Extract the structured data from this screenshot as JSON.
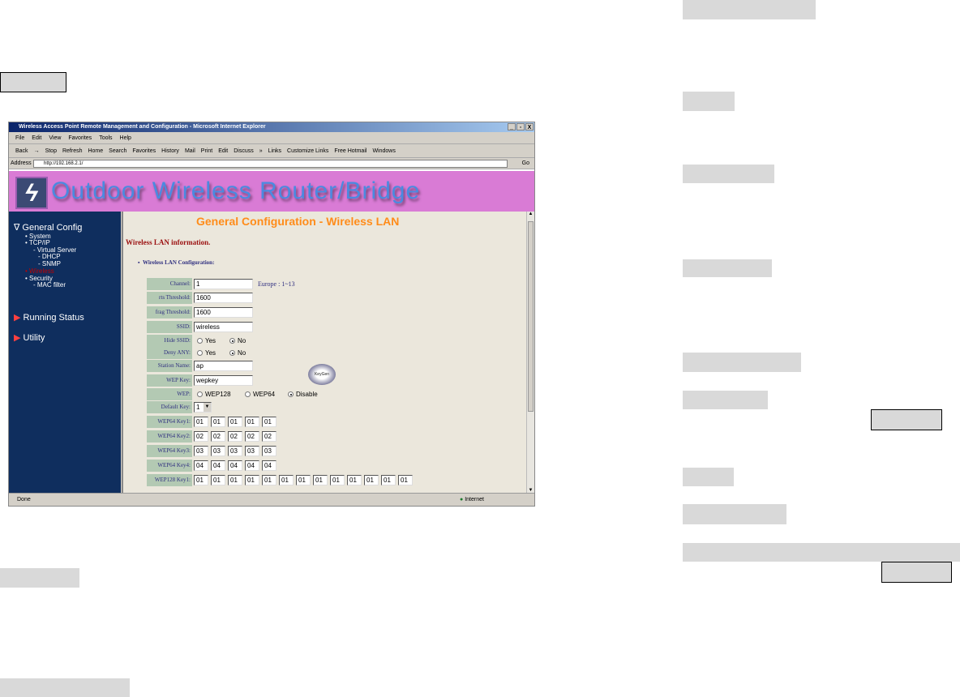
{
  "browser": {
    "title": "Wireless Access Point Remote Management and Configuration - Microsoft Internet Explorer",
    "window_buttons": [
      "_",
      "▫",
      "X"
    ],
    "menu": [
      "File",
      "Edit",
      "View",
      "Favorites",
      "Tools",
      "Help"
    ],
    "toolbar": [
      "Back",
      "→",
      "Stop",
      "Refresh",
      "Home",
      "Search",
      "Favorites",
      "History",
      "Mail",
      "Print",
      "Edit",
      "Discuss",
      "»",
      "Links",
      "Customize Links",
      "Free Hotmail",
      "Windows"
    ],
    "address_label": "Address",
    "address": "http://192.168.2.1/",
    "go": "Go",
    "status_left": "Done",
    "status_zone": "Internet"
  },
  "banner": {
    "title": "Outdoor Wireless Router/Bridge"
  },
  "sidebar": {
    "general": "∇ General Config",
    "items": [
      "• System",
      "• TCP/IP",
      "- Virtual Server",
      "- DHCP",
      "- SNMP",
      "• Wireless",
      "• Security",
      "- MAC filter"
    ],
    "running": "Running Status",
    "utility": "Utility",
    "active_color": "#c00000"
  },
  "main": {
    "title": "General Configuration - Wireless LAN",
    "info": "Wireless LAN information.",
    "subtitle": "Wireless LAN Configuration:",
    "channel_label": "Channel:",
    "channel": "1",
    "channel_note": "Europe : 1~13",
    "rts_label": "rts Threshold:",
    "rts": "1600",
    "frag_label": "frag Threshold:",
    "frag": "1600",
    "ssid_label": "SSID:",
    "ssid": "wireless",
    "hide_label": "Hide SSID:",
    "deny_label": "Deny ANY:",
    "yes": "Yes",
    "no": "No",
    "station_label": "Station Name:",
    "station": "ap",
    "wepkey_label": "WEP Key:",
    "wepkey": "wepkey",
    "keygen": "KeyGen",
    "wep_label": "WEP:",
    "wep_options": [
      "WEP128",
      "WEP64",
      "Disable"
    ],
    "wep_selected": "Disable",
    "defkey_label": "Default Key:",
    "defkey": "1",
    "wep64": [
      {
        "label": "WEP64 Key1:",
        "values": [
          "01",
          "01",
          "01",
          "01",
          "01"
        ]
      },
      {
        "label": "WEP64 Key2:",
        "values": [
          "02",
          "02",
          "02",
          "02",
          "02"
        ]
      },
      {
        "label": "WEP64 Key3:",
        "values": [
          "03",
          "03",
          "03",
          "03",
          "03"
        ]
      },
      {
        "label": "WEP64 Key4:",
        "values": [
          "04",
          "04",
          "04",
          "04",
          "04"
        ]
      }
    ],
    "wep128_label": "WEP128 Key1:",
    "wep128_values": [
      "01",
      "01",
      "01",
      "01",
      "01",
      "01",
      "01",
      "01",
      "01",
      "01",
      "01",
      "01",
      "01"
    ]
  }
}
